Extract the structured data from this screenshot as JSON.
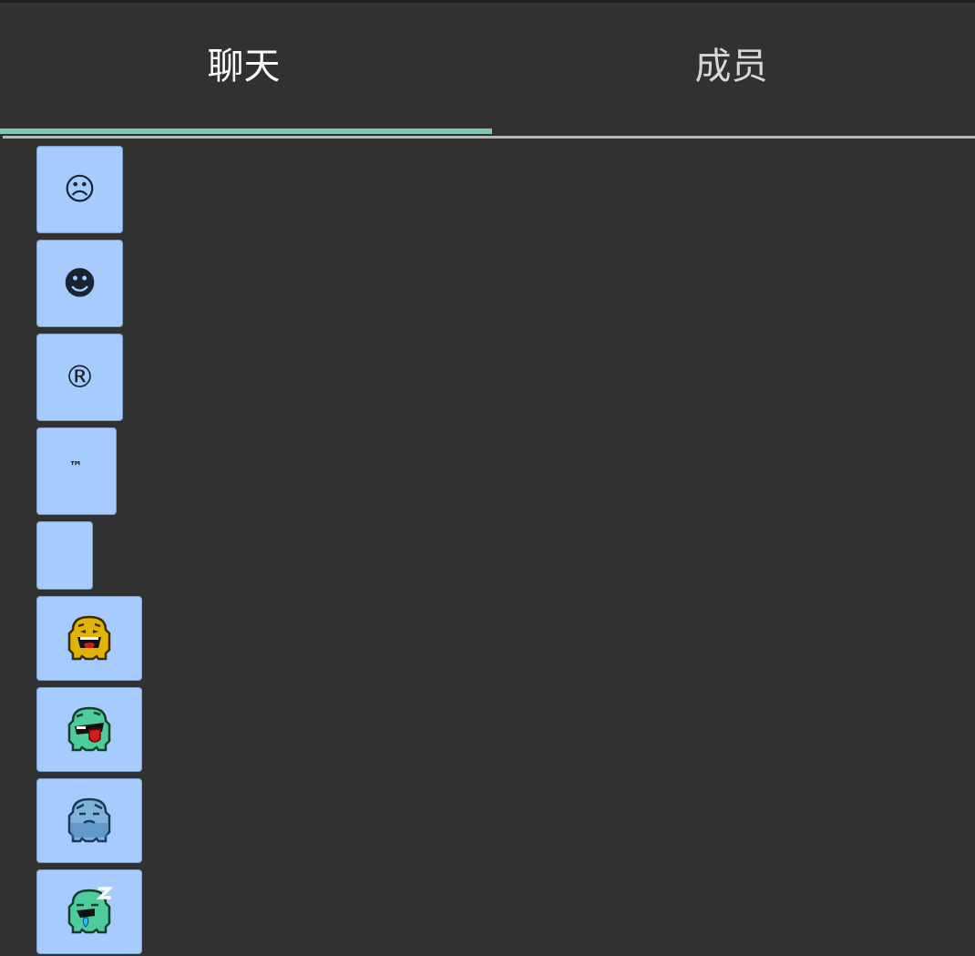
{
  "tabs": [
    {
      "label": "聊天",
      "selected": true
    },
    {
      "label": "成员",
      "selected": false
    }
  ],
  "colors": {
    "background": "#313131",
    "tab_indicator": "#7fc6b6",
    "emoji_button_bg": "#a6ccff"
  },
  "emoji_list": [
    {
      "glyph": "☹"
    },
    {
      "glyph": "☻"
    },
    {
      "glyph": "®"
    },
    {
      "glyph": "™"
    },
    {
      "glyph": ""
    },
    {
      "icon": "yellow-laughing-blob-icon"
    },
    {
      "icon": "green-tongue-out-blob-icon"
    },
    {
      "icon": "blue-sad-blob-icon"
    },
    {
      "icon": "green-sleeping-blob-icon"
    }
  ]
}
